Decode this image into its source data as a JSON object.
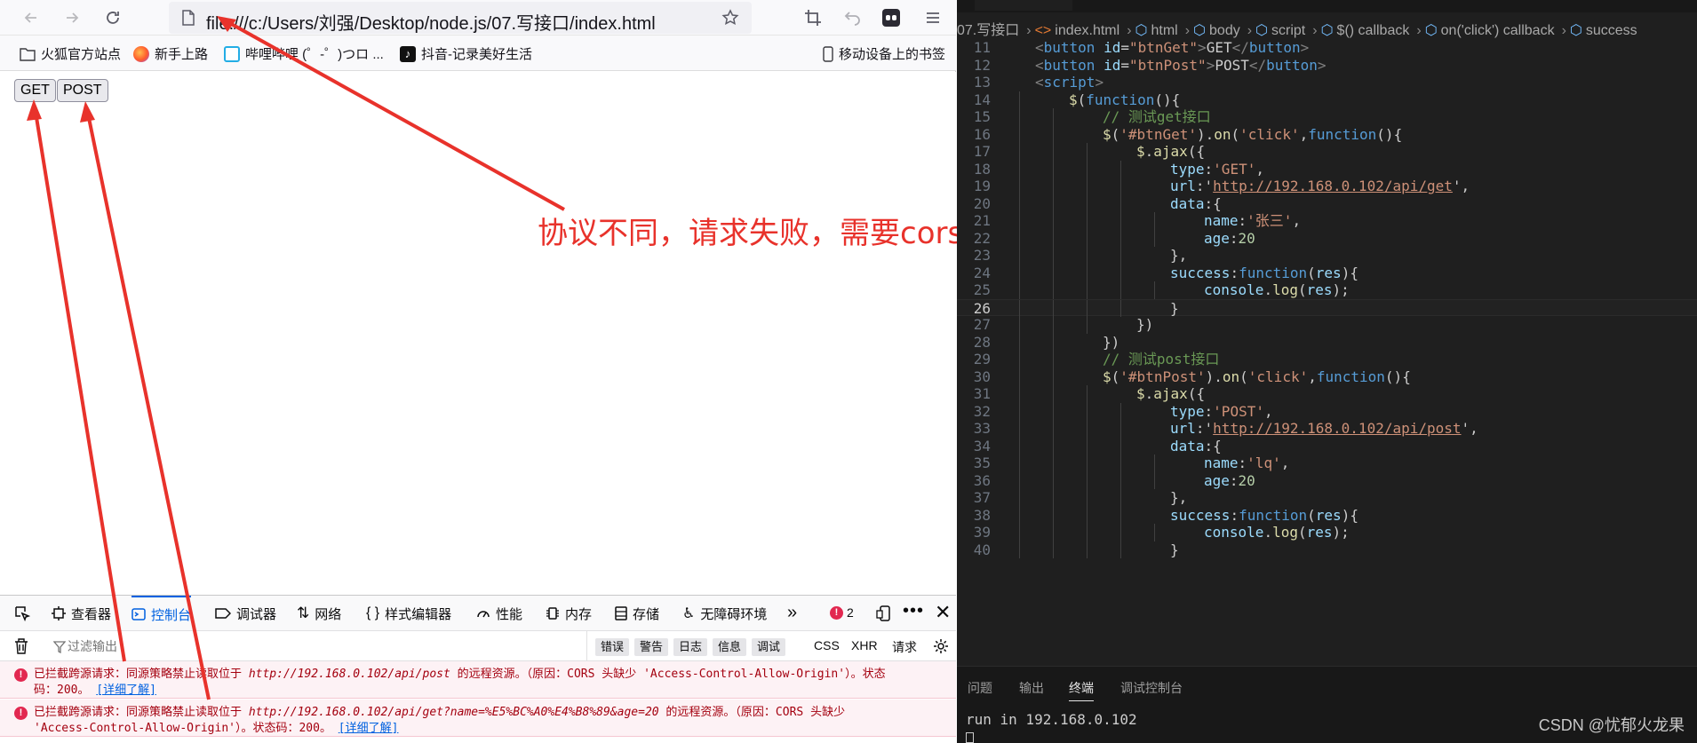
{
  "browser": {
    "url": "file:///c:/Users/刘强/Desktop/node.js/07.写接口/index.html",
    "nav": {
      "back": "back-icon",
      "forward": "forward-icon",
      "reload": "reload-icon"
    },
    "bookmarks": [
      {
        "label": "火狐官方站点",
        "icon": "folder-icon"
      },
      {
        "label": "新手上路",
        "icon": "firefox-icon"
      },
      {
        "label": "哔哩哔哩 (゜-゜)つロ ...",
        "icon": "bilibili-icon"
      },
      {
        "label": "抖音-记录美好生活",
        "icon": "tiktok-icon"
      }
    ],
    "mobile_bookmarks": "移动设备上的书签",
    "page": {
      "get_button": "GET",
      "post_button": "POST"
    },
    "annotation": "协议不同，请求失败，需要cors跨域"
  },
  "devtools": {
    "tabs": [
      {
        "label": "查看器"
      },
      {
        "label": "控制台"
      },
      {
        "label": "调试器"
      },
      {
        "label": "网络"
      },
      {
        "label": "样式编辑器"
      },
      {
        "label": "性能"
      },
      {
        "label": "内存"
      },
      {
        "label": "存储"
      },
      {
        "label": "无障碍环境"
      }
    ],
    "error_count": "2",
    "filter_placeholder": "过滤输出",
    "levels": [
      "错误",
      "警告",
      "日志",
      "信息",
      "调试"
    ],
    "types": [
      "CSS",
      "XHR",
      "请求"
    ],
    "errors": [
      {
        "prefix": "已拦截跨源请求：同源策略禁止读取位于 ",
        "url": "http://192.168.0.102/api/post",
        "suffix": " 的远程资源。（原因：CORS 头缺少 'Access-Control-Allow-Origin'）。状态",
        "line2": "码：200。",
        "link": "[详细了解]"
      },
      {
        "prefix": "已拦截跨源请求：同源策略禁止读取位于 ",
        "url": "http://192.168.0.102/api/get?name=%E5%BC%A0%E4%B8%89&age=20",
        "suffix": " 的远程资源。（原因：CORS 头缺少",
        "line2": "'Access-Control-Allow-Origin'）。状态码：200。",
        "link": "[详细了解]"
      }
    ]
  },
  "editor": {
    "breadcrumbs": [
      "07.写接口",
      "index.html",
      "html",
      "body",
      "script",
      "$() callback",
      "on('click') callback",
      "success"
    ],
    "lines": [
      {
        "n": "11",
        "indent": 1,
        "text": "<button id=\"btnGet\">GET</button>"
      },
      {
        "n": "12",
        "indent": 1,
        "text": "<button id=\"btnPost\">POST</button>"
      },
      {
        "n": "13",
        "indent": 1,
        "text": "<script>"
      },
      {
        "n": "14",
        "indent": 2,
        "text": "$(function(){"
      },
      {
        "n": "15",
        "indent": 3,
        "text": "// 测试get接口"
      },
      {
        "n": "16",
        "indent": 3,
        "text": "$('#btnGet').on('click',function(){"
      },
      {
        "n": "17",
        "indent": 4,
        "text": "$.ajax({"
      },
      {
        "n": "18",
        "indent": 5,
        "text": "type:'GET',"
      },
      {
        "n": "19",
        "indent": 5,
        "text": "url:'http://192.168.0.102/api/get',"
      },
      {
        "n": "20",
        "indent": 5,
        "text": "data:{"
      },
      {
        "n": "21",
        "indent": 6,
        "text": "name:'张三',"
      },
      {
        "n": "22",
        "indent": 6,
        "text": "age:20"
      },
      {
        "n": "23",
        "indent": 5,
        "text": "},"
      },
      {
        "n": "24",
        "indent": 5,
        "text": "success:function(res){"
      },
      {
        "n": "25",
        "indent": 6,
        "text": "console.log(res);"
      },
      {
        "n": "26",
        "indent": 5,
        "text": "}"
      },
      {
        "n": "27",
        "indent": 4,
        "text": "})"
      },
      {
        "n": "28",
        "indent": 3,
        "text": "})"
      },
      {
        "n": "29",
        "indent": 3,
        "text": "// 测试post接口"
      },
      {
        "n": "30",
        "indent": 3,
        "text": "$('#btnPost').on('click',function(){"
      },
      {
        "n": "31",
        "indent": 4,
        "text": "$.ajax({"
      },
      {
        "n": "32",
        "indent": 5,
        "text": "type:'POST',"
      },
      {
        "n": "33",
        "indent": 5,
        "text": "url:'http://192.168.0.102/api/post',"
      },
      {
        "n": "34",
        "indent": 5,
        "text": "data:{"
      },
      {
        "n": "35",
        "indent": 6,
        "text": "name:'lq',"
      },
      {
        "n": "36",
        "indent": 6,
        "text": "age:20"
      },
      {
        "n": "37",
        "indent": 5,
        "text": "},"
      },
      {
        "n": "38",
        "indent": 5,
        "text": "success:function(res){"
      },
      {
        "n": "39",
        "indent": 6,
        "text": "console.log(res);"
      },
      {
        "n": "40",
        "indent": 5,
        "text": "}"
      }
    ],
    "current_line": "26",
    "panel_tabs": [
      "问题",
      "输出",
      "终端",
      "调试控制台"
    ],
    "active_panel_tab": "终端",
    "terminal": "run in 192.168.0.102",
    "watermark": "CSDN @忧郁火龙果"
  },
  "colors": {
    "annotation": "#e8322b",
    "accent": "#0061e0",
    "error": "#a4000f",
    "editor_bg": "#1f1f1f"
  }
}
